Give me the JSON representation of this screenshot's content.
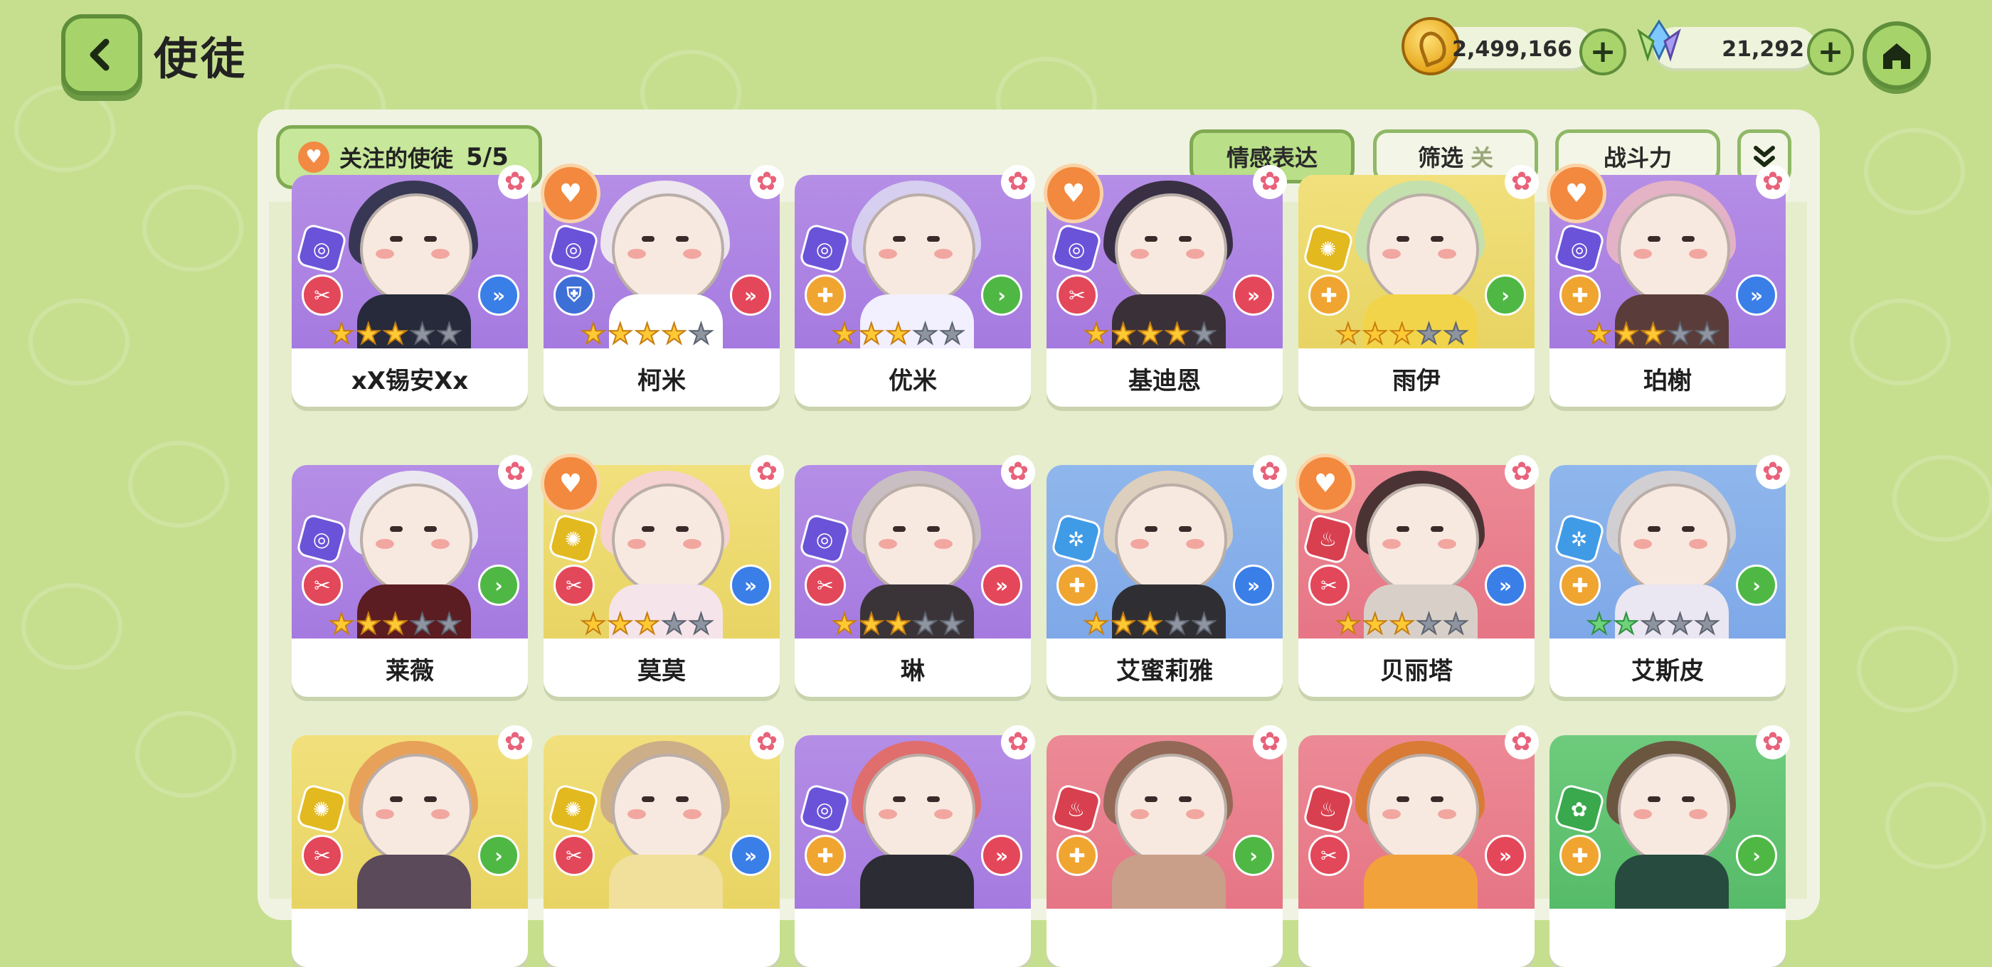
{
  "header": {
    "title": "使徒",
    "back_icon": "chevron-left-icon",
    "home_icon": "home-icon"
  },
  "currencies": [
    {
      "icon": "gold-coin-icon",
      "value": "2,499,166",
      "plus": "+"
    },
    {
      "icon": "crystal-icon",
      "value": "21,292",
      "plus": "+"
    }
  ],
  "toolbar": {
    "favorites_label": "关注的使徒",
    "favorites_count": "5/5",
    "emotion_label": "情感表达",
    "filter_label": "筛选",
    "filter_state": "关",
    "power_label": "战斗力",
    "expand_icon": "double-chevron-down-icon"
  },
  "colors": {
    "background": "#c6df8f",
    "accent_green": "#7faa52",
    "favorite_orange": "#f2893e",
    "element_purple": "#a57ae0",
    "element_yellow": "#e8d463",
    "element_blue": "#7ea8e8",
    "element_red": "#e67585",
    "element_green": "#56bb68"
  },
  "apostles": [
    {
      "name": "xX锡安Xx",
      "theme": "purple",
      "element": "swirl",
      "role": "blade",
      "position": "front",
      "stars": 3,
      "favorite": false
    },
    {
      "name": "柯米",
      "theme": "purple",
      "element": "swirl",
      "role": "shield",
      "position": "back",
      "stars": 4,
      "favorite": true
    },
    {
      "name": "优米",
      "theme": "purple",
      "element": "swirl",
      "role": "heal",
      "position": "mid",
      "stars": 3,
      "favorite": false
    },
    {
      "name": "基迪恩",
      "theme": "purple",
      "element": "swirl",
      "role": "blade",
      "position": "back",
      "stars": 4,
      "favorite": true
    },
    {
      "name": "雨伊",
      "theme": "yellow",
      "element": "sun",
      "role": "heal",
      "position": "mid",
      "stars": 3,
      "favorite": false
    },
    {
      "name": "珀榭",
      "theme": "purple",
      "element": "swirl",
      "role": "heal",
      "position": "front",
      "stars": 3,
      "favorite": true
    },
    {
      "name": "莱薇",
      "theme": "purple",
      "element": "swirl",
      "role": "blade",
      "position": "mid",
      "stars": 3,
      "favorite": false
    },
    {
      "name": "莫莫",
      "theme": "yellow",
      "element": "sun",
      "role": "blade",
      "position": "front",
      "stars": 3,
      "favorite": true
    },
    {
      "name": "琳",
      "theme": "purple",
      "element": "swirl",
      "role": "blade",
      "position": "back",
      "stars": 3,
      "favorite": false
    },
    {
      "name": "艾蜜莉雅",
      "theme": "blue",
      "element": "snow",
      "role": "heal",
      "position": "front",
      "stars": 3,
      "favorite": false
    },
    {
      "name": "贝丽塔",
      "theme": "red",
      "element": "fire",
      "role": "blade",
      "position": "front",
      "stars": 3,
      "favorite": true
    },
    {
      "name": "艾斯皮",
      "theme": "blue",
      "element": "snow",
      "role": "heal",
      "position": "mid",
      "stars": 2,
      "favorite": false
    },
    {
      "name": "",
      "theme": "yellow",
      "element": "sun",
      "role": "blade",
      "position": "mid",
      "stars": 0,
      "favorite": false
    },
    {
      "name": "",
      "theme": "yellow",
      "element": "sun",
      "role": "blade",
      "position": "front",
      "stars": 0,
      "favorite": false
    },
    {
      "name": "",
      "theme": "purple",
      "element": "swirl",
      "role": "heal",
      "position": "back",
      "stars": 0,
      "favorite": false
    },
    {
      "name": "",
      "theme": "red",
      "element": "fire",
      "role": "heal",
      "position": "mid",
      "stars": 0,
      "favorite": false
    },
    {
      "name": "",
      "theme": "red",
      "element": "fire",
      "role": "blade",
      "position": "back",
      "stars": 0,
      "favorite": false
    },
    {
      "name": "",
      "theme": "green",
      "element": "leaf",
      "role": "heal",
      "position": "mid",
      "stars": 0,
      "favorite": false
    }
  ]
}
